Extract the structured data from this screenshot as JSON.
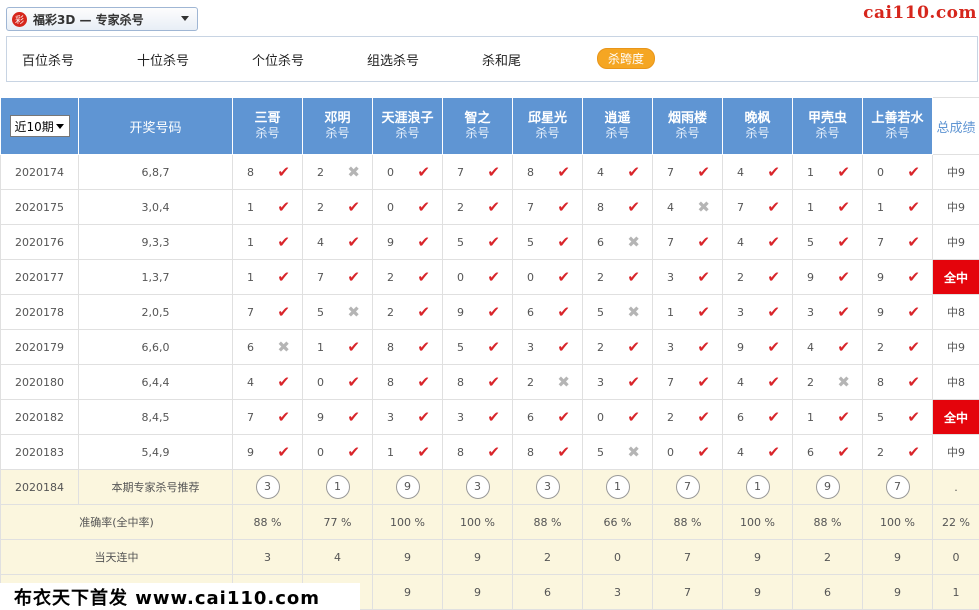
{
  "header": {
    "logo_mark": "彩",
    "selector_label": "福彩3D — 专家杀号",
    "site_logo": "cai110.com"
  },
  "tabs": [
    {
      "label": "百位杀号",
      "active": false
    },
    {
      "label": "十位杀号",
      "active": false
    },
    {
      "label": "个位杀号",
      "active": false
    },
    {
      "label": "组选杀号",
      "active": false
    },
    {
      "label": "杀和尾",
      "active": false
    },
    {
      "label": "杀跨度",
      "active": true
    }
  ],
  "table": {
    "period_select": "近10期",
    "col_draw": "开奖号码",
    "col_total": "总成绩",
    "experts": [
      {
        "name": "三哥",
        "sub": "杀号"
      },
      {
        "name": "邓明",
        "sub": "杀号"
      },
      {
        "name": "天涯浪子",
        "sub": "杀号"
      },
      {
        "name": "智之",
        "sub": "杀号"
      },
      {
        "name": "邱星光",
        "sub": "杀号"
      },
      {
        "name": "逍遥",
        "sub": "杀号"
      },
      {
        "name": "烟雨楼",
        "sub": "杀号"
      },
      {
        "name": "晚枫",
        "sub": "杀号"
      },
      {
        "name": "甲壳虫",
        "sub": "杀号"
      },
      {
        "name": "上善若水",
        "sub": "杀号"
      }
    ],
    "rows": [
      {
        "issue": "2020174",
        "draw": "6,8,7",
        "picks": [
          "8",
          "2",
          "0",
          "7",
          "8",
          "4",
          "7",
          "4",
          "1",
          "0"
        ],
        "hits": [
          1,
          0,
          1,
          1,
          1,
          1,
          1,
          1,
          1,
          1
        ],
        "total": "中9",
        "full": false
      },
      {
        "issue": "2020175",
        "draw": "3,0,4",
        "picks": [
          "1",
          "2",
          "0",
          "2",
          "7",
          "8",
          "4",
          "7",
          "1",
          "1"
        ],
        "hits": [
          1,
          1,
          1,
          1,
          1,
          1,
          0,
          1,
          1,
          1
        ],
        "total": "中9",
        "full": false
      },
      {
        "issue": "2020176",
        "draw": "9,3,3",
        "picks": [
          "1",
          "4",
          "9",
          "5",
          "5",
          "6",
          "7",
          "4",
          "5",
          "7"
        ],
        "hits": [
          1,
          1,
          1,
          1,
          1,
          0,
          1,
          1,
          1,
          1
        ],
        "total": "中9",
        "full": false
      },
      {
        "issue": "2020177",
        "draw": "1,3,7",
        "picks": [
          "1",
          "7",
          "2",
          "0",
          "0",
          "2",
          "3",
          "2",
          "9",
          "9"
        ],
        "hits": [
          1,
          1,
          1,
          1,
          1,
          1,
          1,
          1,
          1,
          1
        ],
        "total": "全中",
        "full": true
      },
      {
        "issue": "2020178",
        "draw": "2,0,5",
        "picks": [
          "7",
          "5",
          "2",
          "9",
          "6",
          "5",
          "1",
          "3",
          "3",
          "9"
        ],
        "hits": [
          1,
          0,
          1,
          1,
          1,
          0,
          1,
          1,
          1,
          1
        ],
        "total": "中8",
        "full": false
      },
      {
        "issue": "2020179",
        "draw": "6,6,0",
        "picks": [
          "6",
          "1",
          "8",
          "5",
          "3",
          "2",
          "3",
          "9",
          "4",
          "2"
        ],
        "hits": [
          0,
          1,
          1,
          1,
          1,
          1,
          1,
          1,
          1,
          1
        ],
        "total": "中9",
        "full": false
      },
      {
        "issue": "2020180",
        "draw": "6,4,4",
        "picks": [
          "4",
          "0",
          "8",
          "8",
          "2",
          "3",
          "7",
          "4",
          "2",
          "8"
        ],
        "hits": [
          1,
          1,
          1,
          1,
          0,
          1,
          1,
          1,
          0,
          1
        ],
        "total": "中8",
        "full": false
      },
      {
        "issue": "2020182",
        "draw": "8,4,5",
        "picks": [
          "7",
          "9",
          "3",
          "3",
          "6",
          "0",
          "2",
          "6",
          "1",
          "5"
        ],
        "hits": [
          1,
          1,
          1,
          1,
          1,
          1,
          1,
          1,
          1,
          1
        ],
        "total": "全中",
        "full": true
      },
      {
        "issue": "2020183",
        "draw": "5,4,9",
        "picks": [
          "9",
          "0",
          "1",
          "8",
          "8",
          "5",
          "0",
          "4",
          "6",
          "2"
        ],
        "hits": [
          1,
          1,
          1,
          1,
          1,
          0,
          1,
          1,
          1,
          1
        ],
        "total": "中9",
        "full": false
      }
    ],
    "recommend": {
      "issue": "2020184",
      "label": "本期专家杀号推荐",
      "picks": [
        "3",
        "1",
        "9",
        "3",
        "3",
        "1",
        "7",
        "1",
        "9",
        "7"
      ],
      "total": "."
    },
    "accuracy": {
      "label": "准确率(全中率)",
      "values": [
        "88 %",
        "77 %",
        "100 %",
        "100 %",
        "88 %",
        "66 %",
        "88 %",
        "100 %",
        "88 %",
        "100 %"
      ],
      "total": "22 %"
    },
    "streak": {
      "label": "当天连中",
      "values": [
        "3",
        "4",
        "9",
        "9",
        "2",
        "0",
        "7",
        "9",
        "2",
        "9"
      ],
      "total": "0"
    },
    "last_row": {
      "values": [
        "",
        "",
        "9",
        "9",
        "6",
        "3",
        "7",
        "9",
        "6",
        "9"
      ],
      "total": "1"
    }
  },
  "footer_brand": "布衣天下首发 www.cai110.com",
  "colors": {
    "header_blue": "#5f95d3",
    "hit_red": "#d9252b",
    "full_red": "#e4040c",
    "active_tab": "#f5a623",
    "summary_bg": "#fbf6de"
  },
  "icons": {
    "hit": "check-icon",
    "miss": "cross-icon"
  }
}
